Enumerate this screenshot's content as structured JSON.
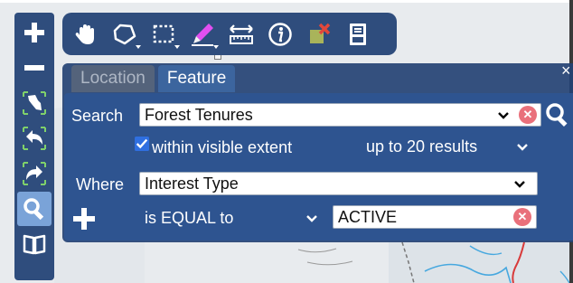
{
  "app": {
    "colors": {
      "toolbar": "#2f4d7d",
      "panel": "#2e5490",
      "active_tool": "#7aa3d8",
      "clear_red": "#e9707b"
    }
  },
  "map": {
    "description_icons": [
      "road-line",
      "river-line",
      "boundary-line"
    ]
  },
  "left_toolbar": {
    "items": [
      {
        "icon": "zoom-in-icon"
      },
      {
        "icon": "zoom-out-icon"
      },
      {
        "icon": "zoom-province-icon"
      },
      {
        "icon": "previous-extent-icon"
      },
      {
        "icon": "next-extent-icon"
      },
      {
        "icon": "search-icon",
        "active": true
      },
      {
        "icon": "book-icon"
      }
    ]
  },
  "top_toolbar": {
    "items": [
      {
        "icon": "pan-hand-icon"
      },
      {
        "icon": "polygon-select-icon"
      },
      {
        "icon": "rectangle-select-icon"
      },
      {
        "icon": "draw-pen-icon"
      },
      {
        "icon": "measure-icon"
      },
      {
        "icon": "info-icon"
      },
      {
        "icon": "clear-selection-icon"
      },
      {
        "icon": "save-icon"
      }
    ]
  },
  "search_panel": {
    "tabs": [
      "Location",
      "Feature"
    ],
    "active_tab": "Feature",
    "close_label": "×",
    "search_label": "Search",
    "search_value": "Forest Tenures",
    "within_visible_extent_label": "within visible extent",
    "within_visible_extent_checked": true,
    "result_limit": "up to 20 results",
    "where_label": "Where",
    "where_field": "Interest Type",
    "operator": "is EQUAL to",
    "value": "ACTIVE",
    "clear_symbol": "✕",
    "add_symbol": "+"
  }
}
